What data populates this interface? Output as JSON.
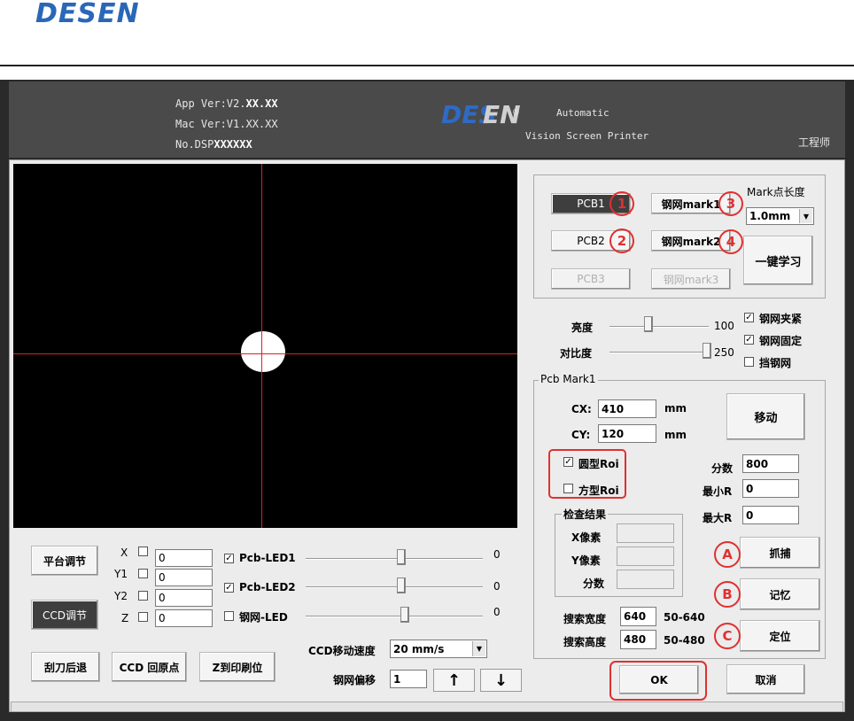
{
  "brand": {
    "logo_text": "DESEN",
    "logo_part1": "DES",
    "logo_part2": "EN",
    "registered": "®"
  },
  "header": {
    "app_ver_label": "App Ver:V2.",
    "app_ver_value": "XX.XX",
    "mac_ver": "Mac Ver:V1.XX.XX",
    "dsp_label": "No.DSP",
    "dsp_value": "XXXXXX",
    "product_line1": "Automatic",
    "product_line2": "Vision Screen Printer",
    "user_role": "工程师"
  },
  "marks": {
    "pcb1": "PCB1",
    "pcb2": "PCB2",
    "pcb3": "PCB3",
    "stencil1": "钢网mark1",
    "stencil2": "钢网mark2",
    "stencil3": "钢网mark3",
    "mark_len_label": "Mark点长度",
    "mark_len_value": "1.0mm",
    "learn_button": "一键学习",
    "annot": [
      "1",
      "2",
      "3",
      "4"
    ]
  },
  "image_adjust": {
    "brightness_label": "亮度",
    "brightness_value": "100",
    "contrast_label": "对比度",
    "contrast_value": "250",
    "stencil_clamp": "钢网夹紧",
    "stencil_fixed": "钢网固定",
    "block_stencil": "挡钢网"
  },
  "pcb_mark": {
    "title": "Pcb Mark1",
    "cx_label": "CX:",
    "cx_value": "410",
    "cy_label": "CY:",
    "cy_value": "120",
    "unit": "mm",
    "move_button": "移动",
    "round_roi": "圆型Roi",
    "square_roi": "方型Roi",
    "score_label": "分数",
    "score_value": "800",
    "min_r_label": "最小R",
    "min_r_value": "0",
    "max_r_label": "最大R",
    "max_r_value": "0",
    "result_title": "检查结果",
    "x_pixel": "X像素",
    "y_pixel": "Y像素",
    "result_score": "分数",
    "search_width_label": "搜索宽度",
    "search_width_value": "640",
    "search_width_range": "50-640",
    "search_height_label": "搜索高度",
    "search_height_value": "480",
    "search_height_range": "50-480",
    "capture_button": "抓捕",
    "memory_button": "记忆",
    "locate_button": "定位",
    "annot": [
      "A",
      "B",
      "C"
    ]
  },
  "bottom": {
    "platform_button": "平台调节",
    "ccd_adjust_button": "CCD调节",
    "x_label": "X",
    "y1_label": "Y1",
    "y2_label": "Y2",
    "z_label": "Z",
    "x_value": "0",
    "y1_value": "0",
    "y2_value": "0",
    "z_value": "0",
    "led1_label": "Pcb-LED1",
    "led2_label": "Pcb-LED2",
    "led3_label": "钢网-LED",
    "led1_value": "0",
    "led2_value": "0",
    "led3_value": "0",
    "led1_level": 0.54,
    "led2_level": 0.54,
    "led3_level": 0.56,
    "squeegee_button": "刮刀后退",
    "ccd_home_button": "CCD 回原点",
    "z_print_button": "Z到印刷位",
    "speed_label": "CCD移动速度",
    "speed_value": "20 mm/s",
    "offset_label": "钢网偏移",
    "offset_value": "1",
    "up_arrow": "↑",
    "down_arrow": "↓"
  },
  "dialog": {
    "ok_button": "OK",
    "cancel_button": "取消"
  },
  "colors": {
    "accent_blue": "#2f6ac4",
    "annotation_red": "#e03030",
    "crosshair": "#e02020"
  }
}
